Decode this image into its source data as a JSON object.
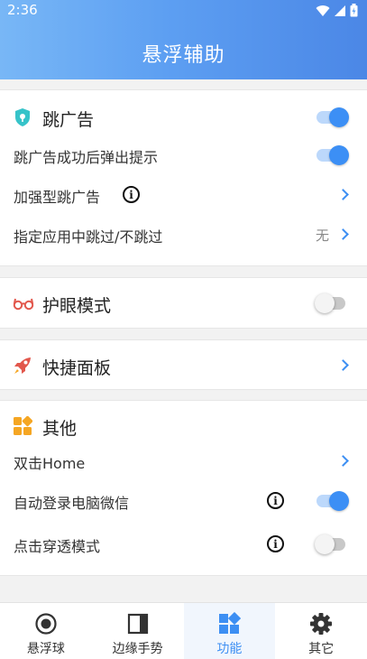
{
  "status": {
    "time": "2:36"
  },
  "header": {
    "title": "悬浮辅助"
  },
  "skip_ads": {
    "title": "跳广告",
    "enabled": true,
    "items": [
      {
        "label": "跳广告成功后弹出提示",
        "toggle": true
      },
      {
        "label": "加强型跳广告"
      },
      {
        "label": "指定应用中跳过/不跳过",
        "value": "无"
      }
    ]
  },
  "eye_mode": {
    "title": "护眼模式",
    "enabled": false
  },
  "quick_panel": {
    "title": "快捷面板"
  },
  "other": {
    "title": "其他",
    "items": [
      {
        "label": "双击Home"
      },
      {
        "label": "自动登录电脑微信",
        "toggle": true
      },
      {
        "label": "点击穿透模式",
        "toggle": false
      }
    ]
  },
  "tabs": [
    {
      "label": "悬浮球",
      "icon": "floating-ball-icon"
    },
    {
      "label": "边缘手势",
      "icon": "edge-gesture-icon"
    },
    {
      "label": "功能",
      "icon": "function-icon",
      "active": true
    },
    {
      "label": "其它",
      "icon": "gear-icon"
    }
  ],
  "colors": {
    "accent": "#3d8ff3",
    "header_start": "#78b7f6",
    "header_end": "#4b87e6"
  }
}
